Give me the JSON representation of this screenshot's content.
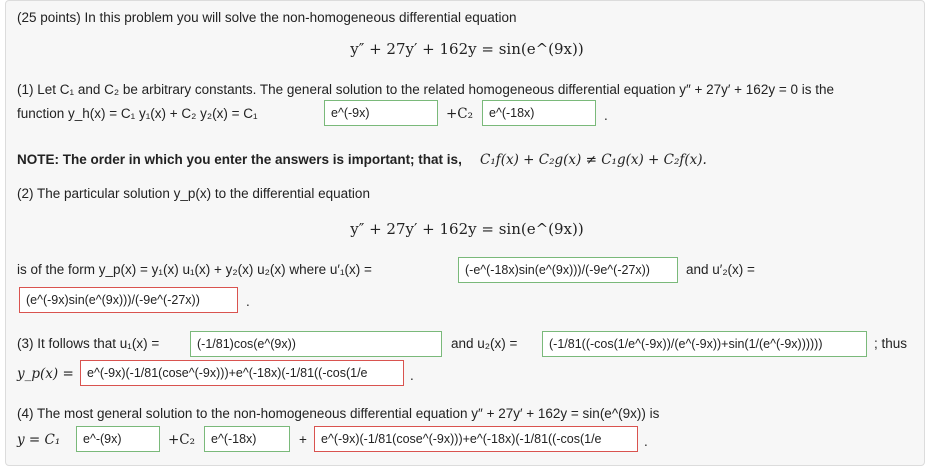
{
  "intro": "(25 points) In this problem you will solve the non-homogeneous differential equation",
  "equation": "y″ + 27y′ + 162y = sin(e^(9x))",
  "part1": {
    "text_a": "(1) Let C₁ and C₂ be arbitrary constants. The general solution to the related homogeneous differential equation y″ + 27y′ + 162y = 0 is the",
    "text_b": "function y_h(x) = C₁ y₁(x) + C₂ y₂(x) = C₁",
    "plus_c2": "+C₂",
    "answer_y1": "e^(-9x)",
    "answer_y2": "e^(-18x)",
    "period": "."
  },
  "note": {
    "label": "NOTE: The order in which you enter the answers is important; that is,",
    "math": "C₁f(x) + C₂g(x) ≠ C₁g(x) + C₂f(x)."
  },
  "part2": {
    "text_a": "(2) The particular solution y_p(x) to the differential equation",
    "equation": "y″ + 27y′ + 162y = sin(e^(9x))",
    "text_b": "is of the form y_p(x) = y₁(x) u₁(x) + y₂(x) u₂(x) where u′₁(x) =",
    "answer_u1p": "(-e^(-18x)sin(e^(9x)))/(-9e^(-27x))",
    "and_u2p": "and u′₂(x) =",
    "answer_u2p": "(e^(-9x)sin(e^(9x)))/(-9e^(-27x))",
    "period": "."
  },
  "part3": {
    "text_a": "(3) It follows that u₁(x) =",
    "answer_u1": "(-1/81)cos(e^(9x))",
    "and_u2": "and u₂(x) =",
    "answer_u2": "(-1/81((-cos(1/e^(-9x))/(e^(-9x))+sin(1/(e^(-9x))))))",
    "thus": "; thus",
    "yp_label": "y_p(x) =",
    "answer_yp": "e^(-9x)(-1/81(cose^(-9x)))+e^(-18x)(-1/81((-cos(1/e",
    "period": "."
  },
  "part4": {
    "text_a": "(4) The most general solution to the non-homogeneous differential equation y″ + 27y′ + 162y = sin(e^(9x)) is",
    "y_c1": "y = C₁",
    "answer_a": "e^-(9x)",
    "plus_c2": "+C₂",
    "answer_b": "e^(-18x)",
    "plus": "+",
    "answer_c": "e^(-9x)(-1/81(cose^(-9x)))+e^(-18x)(-1/81((-cos(1/e",
    "period": "."
  }
}
